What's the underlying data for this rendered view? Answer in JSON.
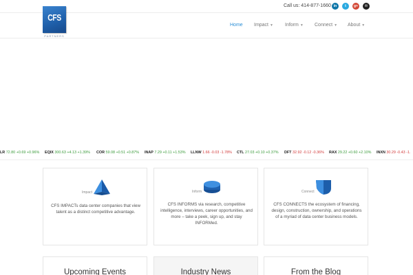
{
  "header": {
    "call_text": "Call us: 414-877-1660",
    "logo_text": "CFS",
    "logo_sub": "PARTNERS",
    "social": [
      {
        "name": "linkedin-icon",
        "glyph": "in",
        "color": "#0e76a8"
      },
      {
        "name": "twitter-icon",
        "glyph": "t",
        "color": "#2aa9e0"
      },
      {
        "name": "google-plus-icon",
        "glyph": "g+",
        "color": "#d34836"
      },
      {
        "name": "email-icon",
        "glyph": "✉",
        "color": "#222222"
      }
    ]
  },
  "nav": [
    {
      "label": "Home",
      "active": true,
      "has_menu": false
    },
    {
      "label": "Impact",
      "active": false,
      "has_menu": true
    },
    {
      "label": "Inform",
      "active": false,
      "has_menu": true
    },
    {
      "label": "Connect",
      "active": false,
      "has_menu": true
    },
    {
      "label": "About",
      "active": false,
      "has_menu": true
    }
  ],
  "ticker": [
    {
      "symbol": "LR",
      "price": "72.80",
      "change": "+0.69",
      "pct": "+0.96%",
      "dir": "up"
    },
    {
      "symbol": "EQIX",
      "price": "300.63",
      "change": "+4.13",
      "pct": "+1.39%",
      "dir": "up"
    },
    {
      "symbol": "COR",
      "price": "59.08",
      "change": "+0.51",
      "pct": "+0.87%",
      "dir": "up"
    },
    {
      "symbol": "INAP",
      "price": "7.29",
      "change": "+0.11",
      "pct": "+1.53%",
      "dir": "up"
    },
    {
      "symbol": "LLNW",
      "price": "1.66",
      "change": "-0.03",
      "pct": "-1.78%",
      "dir": "down"
    },
    {
      "symbol": "CTL",
      "price": "27.03",
      "change": "+0.10",
      "pct": "+0.37%",
      "dir": "up"
    },
    {
      "symbol": "DFT",
      "price": "32.92",
      "change": "-0.12",
      "pct": "-0.36%",
      "dir": "down"
    },
    {
      "symbol": "RAX",
      "price": "29.22",
      "change": "+0.60",
      "pct": "+2.10%",
      "dir": "up"
    },
    {
      "symbol": "INXN",
      "price": "30.29",
      "change": "-0.43",
      "pct": "-1.",
      "dir": "down"
    }
  ],
  "cards": [
    {
      "label": "Impact",
      "text": "CFS IMPACTs data center companies that view talent as a distinct competitive advantage."
    },
    {
      "label": "Inform",
      "text": "CFS INFORMS via research, competitive intelligence, interviews, career opportunities, and more – take a peek, sign up, and stay INFORMed."
    },
    {
      "label": "Connect",
      "text": "CFS CONNECTS the ecosystem of financing, design, construction, ownership, and operations of a myriad of data center business models."
    }
  ],
  "boxes": [
    {
      "title": "Upcoming Events"
    },
    {
      "title": "Industry News"
    },
    {
      "title": "From the Blog"
    }
  ],
  "colors": {
    "accent": "#2a8ed6",
    "brand_blue": "#1f5fa9",
    "up": "#3c9b3c",
    "down": "#d23a3a"
  }
}
